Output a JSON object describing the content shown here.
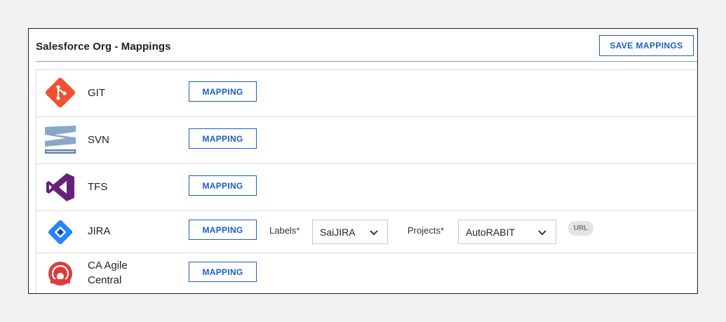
{
  "panel": {
    "title": "Salesforce Org - Mappings",
    "save_label": "SAVE MAPPINGS"
  },
  "rows": [
    {
      "name": "GIT",
      "icon": "git-logo-icon",
      "mapping_label": "MAPPING"
    },
    {
      "name": "SVN",
      "icon": "svn-logo-icon",
      "mapping_label": "MAPPING"
    },
    {
      "name": "TFS",
      "icon": "tfs-logo-icon",
      "mapping_label": "MAPPING"
    },
    {
      "name": "JIRA",
      "icon": "jira-logo-icon",
      "mapping_label": "MAPPING",
      "labels_field": {
        "label": "Labels",
        "required_mark": "*",
        "value": "SaiJIRA"
      },
      "projects_field": {
        "label": "Projects",
        "required_mark": "*",
        "value": "AutoRABIT"
      },
      "url_badge": "URL"
    },
    {
      "name_line1": "CA Agile",
      "name_line2": "Central",
      "icon": "ca-agile-central-logo-icon",
      "mapping_label": "MAPPING"
    }
  ],
  "colors": {
    "accent": "#1a5fc9",
    "required": "#d0021b",
    "git": "#f05033",
    "svn": "#8aa6c9",
    "tfs": "#68217a",
    "jira": "#2684ff",
    "ca": "#e03a3e"
  }
}
